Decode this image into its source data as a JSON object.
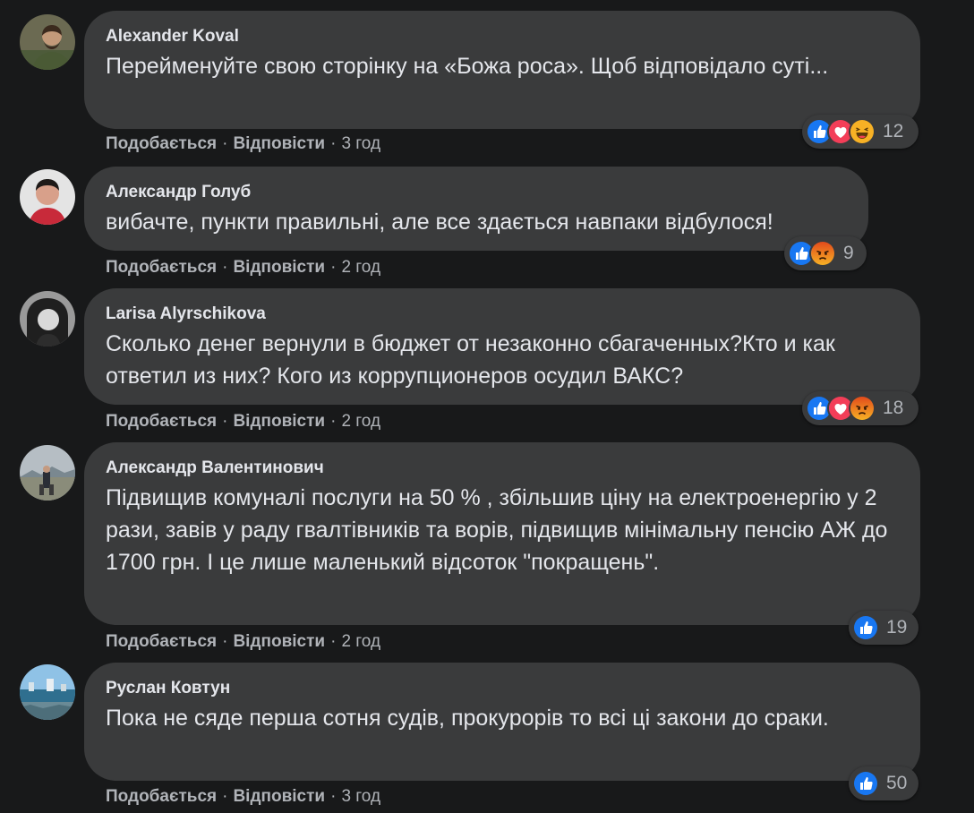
{
  "actions": {
    "like": "Подобається",
    "reply": "Відповісти",
    "sep": "·"
  },
  "colors": {
    "background": "#18191a",
    "bubble": "#3a3b3c",
    "like_blue": "#1877f2",
    "love_red": "#f33e58",
    "haha_yellow": "#f7b125",
    "angry_orange": "#e9710f"
  },
  "comments": [
    {
      "author": "Alexander Koval",
      "text": "Перейменуйте свою сторінку на «Божа роса». Щоб відповідало суті...",
      "time": "3 год",
      "reactions": [
        "like-icon",
        "love-icon",
        "haha-icon"
      ],
      "reaction_count": "12"
    },
    {
      "author": "Александр Голуб",
      "text": "вибачте, пункти правильні, але все здається навпаки відбулося!",
      "time": "2 год",
      "reactions": [
        "like-icon",
        "angry-icon"
      ],
      "reaction_count": "9"
    },
    {
      "author": "Larisa Alyrschikova",
      "text": "Сколько денег вернули в бюджет от незаконно сбагаченных?Кто и как ответил из них? Кого из коррупционеров осудил ВАКС?",
      "time": "2 год",
      "reactions": [
        "like-icon",
        "love-icon",
        "angry-icon"
      ],
      "reaction_count": "18"
    },
    {
      "author": "Александр Валентинович",
      "text": "Підвищив комуналі послуги на 50 % , збільшив ціну на електроенергію у 2 рази, завів у раду гвалтівників та ворів, підвищив мінімальну пенсію АЖ до 1700 грн. І це лише маленький відсоток \"покращень\".",
      "time": "2 год",
      "reactions": [
        "like-icon"
      ],
      "reaction_count": "19"
    },
    {
      "author": "Руслан Ковтун",
      "text": "Пока не сяде перша сотня судів, прокурорів то всі ці закони до сраки.",
      "time": "3 год",
      "reactions": [
        "like-icon"
      ],
      "reaction_count": "50"
    }
  ]
}
